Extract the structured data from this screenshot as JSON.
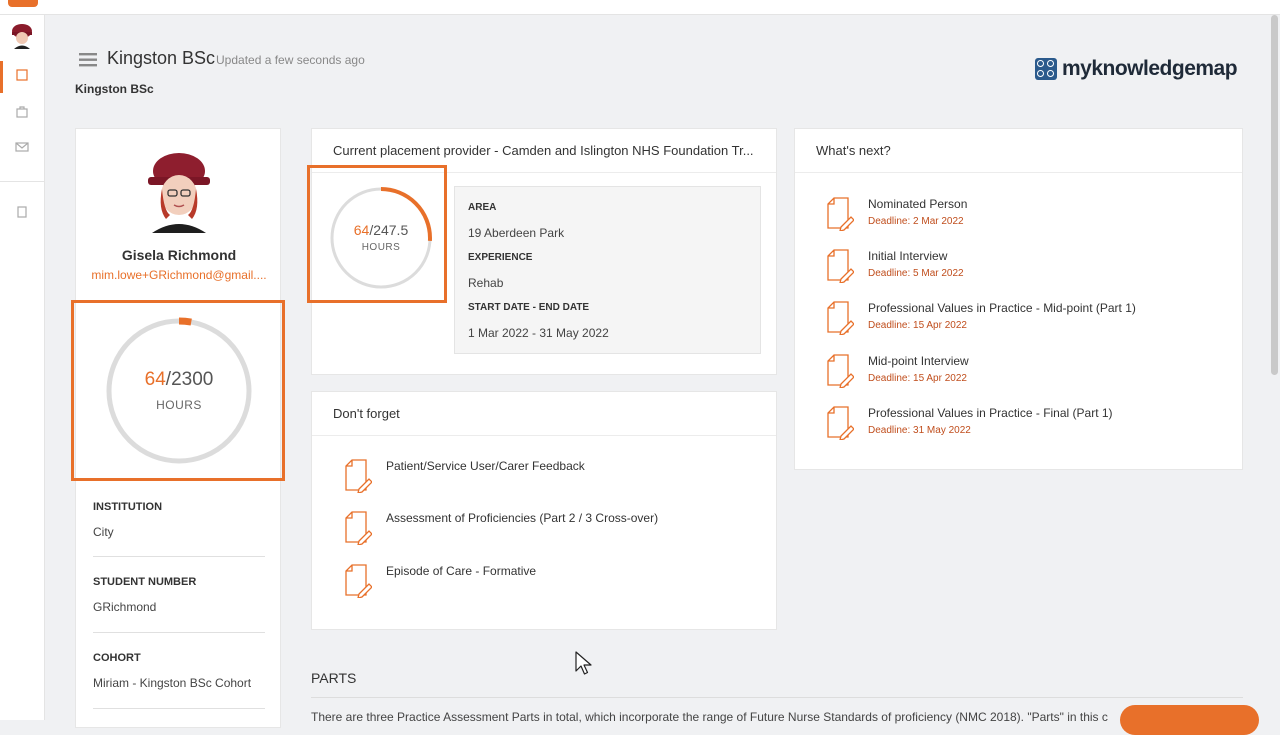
{
  "header": {
    "title": "Kingston BSc",
    "updated": "Updated a few seconds ago",
    "subtitle": "Kingston BSc",
    "brand": "myknowledgemap"
  },
  "profile": {
    "name": "Gisela Richmond",
    "email": "mim.lowe+GRichmond@gmail....",
    "hours_done": "64",
    "hours_total": "/2300",
    "hours_unit": "HOURS",
    "progress": 0.028,
    "fields": [
      {
        "label": "INSTITUTION",
        "value": "City"
      },
      {
        "label": "STUDENT NUMBER",
        "value": "GRichmond"
      },
      {
        "label": "COHORT",
        "value": "Miriam - Kingston BSc Cohort"
      }
    ]
  },
  "placement": {
    "header": "Current placement provider - Camden and Islington NHS Foundation Tr...",
    "hours_done": "64",
    "hours_total": "/247.5",
    "hours_unit": "HOURS",
    "progress": 0.259,
    "area_label": "AREA",
    "area_value": "19 Aberdeen Park",
    "experience_label": "EXPERIENCE",
    "experience_value": "Rehab",
    "dates_label": "START DATE - END DATE",
    "dates_value": "1 Mar 2022 - 31 May 2022"
  },
  "dont_forget": {
    "header": "Don't forget",
    "items": [
      "Patient/Service User/Carer Feedback",
      "Assessment of Proficiencies (Part 2 / 3 Cross-over)",
      "Episode of Care - Formative"
    ]
  },
  "whats_next": {
    "header": "What's next?",
    "items": [
      {
        "title": "Nominated Person",
        "deadline": "Deadline: 2 Mar 2022"
      },
      {
        "title": "Initial Interview",
        "deadline": "Deadline: 5 Mar 2022"
      },
      {
        "title": "Professional Values in Practice - Mid-point (Part 1)",
        "deadline": "Deadline: 15 Apr 2022"
      },
      {
        "title": "Mid-point Interview",
        "deadline": "Deadline: 15 Apr 2022"
      },
      {
        "title": "Professional Values in Practice - Final (Part 1)",
        "deadline": "Deadline: 31 May 2022"
      }
    ]
  },
  "parts": {
    "title": "PARTS",
    "text": "There are three Practice Assessment Parts in total, which incorporate the range of Future Nurse Standards of proficiency (NMC 2018). \"Parts\" in this c"
  },
  "colors": {
    "accent": "#e8702a",
    "deadline": "#c04e1d",
    "brand": "#2b5a8c"
  },
  "icons": {
    "sidebar": [
      "user-avatar",
      "dashboard-icon",
      "briefcase-icon",
      "mail-icon",
      "document-icon"
    ],
    "task": "document-edit-icon",
    "title": "list-icon"
  }
}
